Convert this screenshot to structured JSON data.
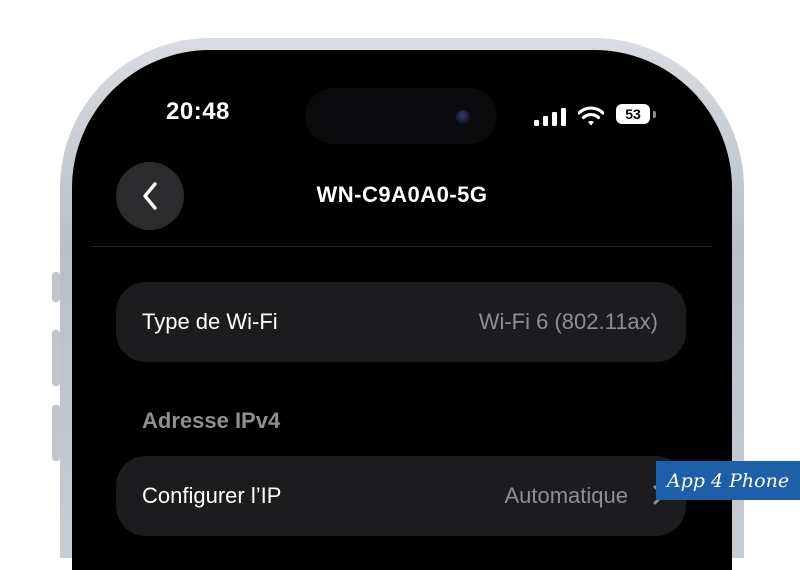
{
  "status_bar": {
    "time": "20:48",
    "battery_level": "53",
    "icons": [
      "cellular-signal-icon",
      "wifi-icon",
      "battery-icon"
    ]
  },
  "nav": {
    "back_icon": "chevron-left-icon",
    "title": "WN-C9A0A0-5G"
  },
  "rows": {
    "wifi_type": {
      "label": "Type de Wi-Fi",
      "value": "Wi-Fi 6 (802.11ax)"
    },
    "configure_ip": {
      "label": "Configurer l’IP",
      "value": "Automatique",
      "icon": "chevron-right-icon"
    }
  },
  "sections": {
    "ipv4_header": "Adresse IPv4"
  },
  "watermark": {
    "brand": "App 4 Phone"
  },
  "colors": {
    "screen_background": "#000000",
    "card_background": "#1c1c1e",
    "secondary_text": "#8e8e93",
    "badge_blue": "#1d5fa8"
  }
}
